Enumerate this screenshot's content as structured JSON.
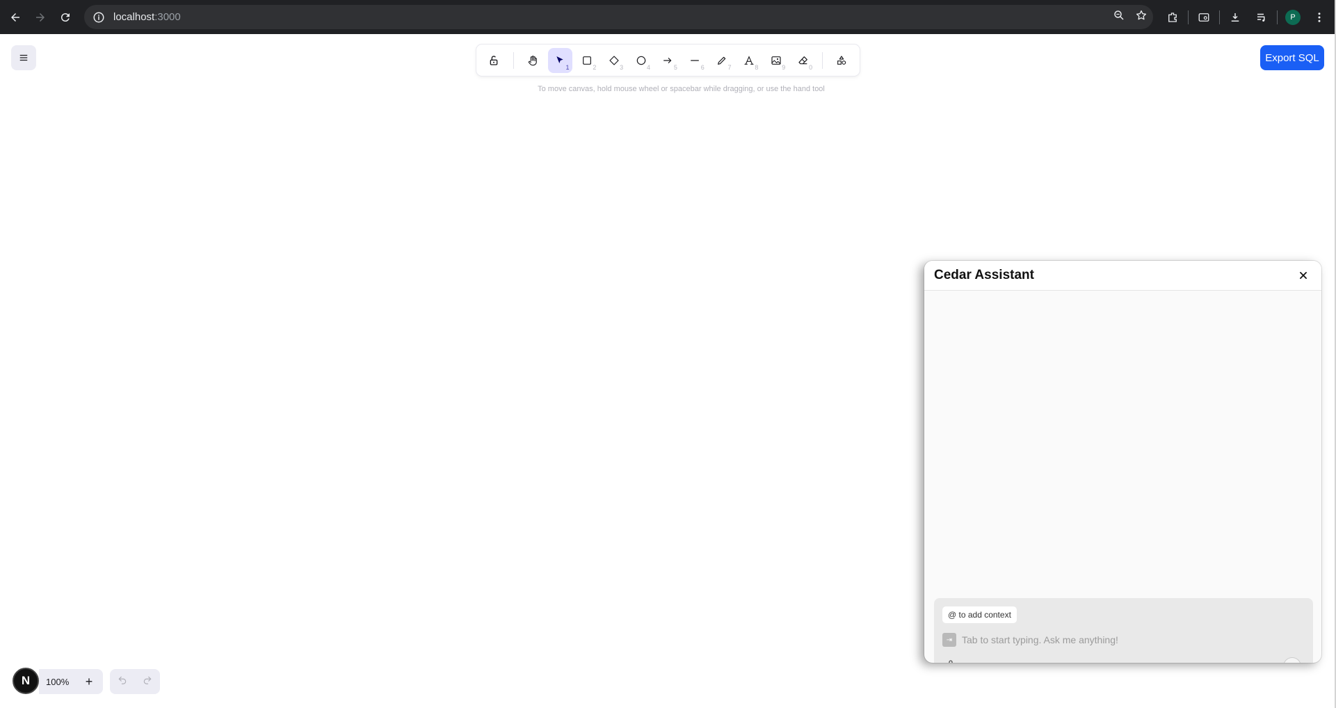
{
  "browser": {
    "url_host": "localhost",
    "url_port": ":3000",
    "profile_initial": "P"
  },
  "toolbar": {
    "tools": [
      {
        "name": "lock",
        "key": ""
      },
      {
        "name": "hand",
        "key": ""
      },
      {
        "name": "selection",
        "key": "1"
      },
      {
        "name": "rectangle",
        "key": "2"
      },
      {
        "name": "diamond",
        "key": "3"
      },
      {
        "name": "ellipse",
        "key": "4"
      },
      {
        "name": "arrow",
        "key": "5"
      },
      {
        "name": "line",
        "key": "6"
      },
      {
        "name": "draw",
        "key": "7"
      },
      {
        "name": "text",
        "key": "8"
      },
      {
        "name": "image",
        "key": "9"
      },
      {
        "name": "eraser",
        "key": "0"
      },
      {
        "name": "more-tools",
        "key": ""
      }
    ],
    "active_tool": "selection"
  },
  "canvas": {
    "hint": "To move canvas, hold mouse wheel or spacebar while dragging, or use the hand tool",
    "export_label": "Export SQL",
    "zoom": "100%",
    "logo_letter": "N"
  },
  "assistant": {
    "title": "Cedar Assistant",
    "context_chip": "@ to add context",
    "input_placeholder": "Tab to start typing. Ask me anything!",
    "tab_hint": "⇥"
  },
  "colors": {
    "accent": "#1a5ff5",
    "active_tool_bg": "#e0dfff",
    "chrome_bg": "#202124"
  }
}
